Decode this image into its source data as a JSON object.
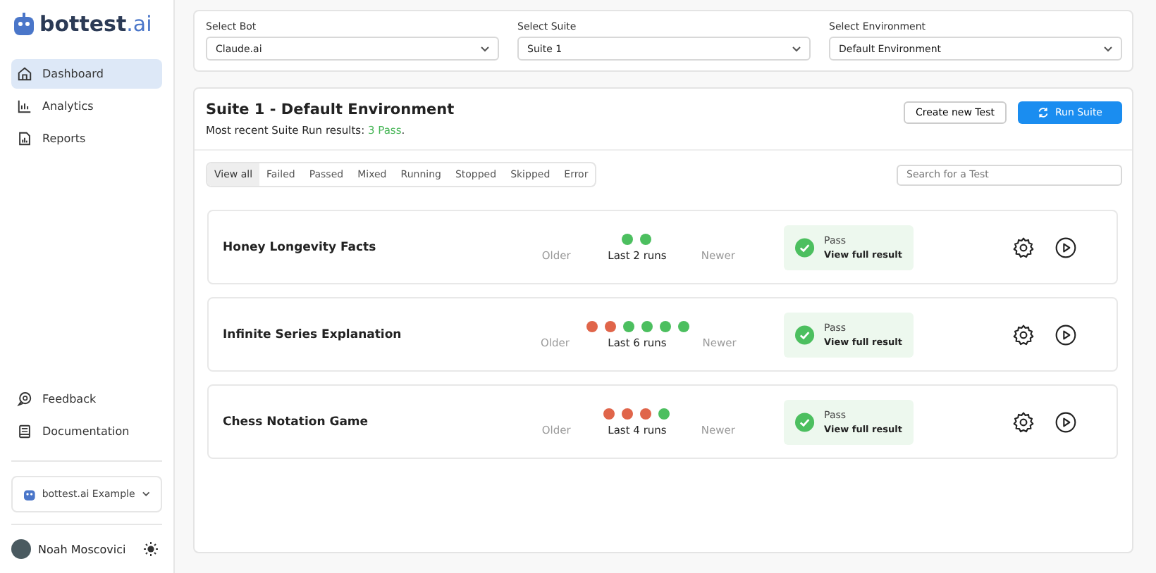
{
  "brand": {
    "name": "bottest",
    "suffix": ".ai"
  },
  "nav": [
    {
      "label": "Dashboard",
      "selected": true
    },
    {
      "label": "Analytics",
      "selected": false
    },
    {
      "label": "Reports",
      "selected": false
    }
  ],
  "bottom_nav": [
    {
      "label": "Feedback"
    },
    {
      "label": "Documentation"
    }
  ],
  "workspace": {
    "label": "bottest.ai Example"
  },
  "user": {
    "name": "Noah Moscovici"
  },
  "selects": [
    {
      "label": "Select Bot",
      "value": "Claude.ai"
    },
    {
      "label": "Select Suite",
      "value": "Suite 1"
    },
    {
      "label": "Select Environment",
      "value": "Default Environment"
    }
  ],
  "suite": {
    "title": "Suite 1 - Default Environment",
    "summary_prefix": "Most recent Suite Run results: ",
    "summary_result": "3 Pass",
    "summary_suffix": ".",
    "create_button": "Create new Test",
    "run_button": "Run Suite"
  },
  "filters": [
    {
      "label": "View all",
      "selected": true
    },
    {
      "label": "Failed",
      "selected": false
    },
    {
      "label": "Passed",
      "selected": false
    },
    {
      "label": "Mixed",
      "selected": false
    },
    {
      "label": "Running",
      "selected": false
    },
    {
      "label": "Stopped",
      "selected": false
    },
    {
      "label": "Skipped",
      "selected": false
    },
    {
      "label": "Error",
      "selected": false
    }
  ],
  "search": {
    "placeholder": "Search for a Test"
  },
  "tests": [
    {
      "name": "Honey Longevity Facts",
      "older": "Older",
      "runs_label": "Last 2 runs",
      "newer": "Newer",
      "runs": [
        {
          "color": "#4cbf5f"
        },
        {
          "color": "#4cbf5f"
        }
      ],
      "status": {
        "kind": "pass",
        "label": "Pass",
        "link": "View full result"
      }
    },
    {
      "name": "Infinite Series Explanation",
      "older": "Older",
      "runs_label": "Last 6 runs",
      "newer": "Newer",
      "runs": [
        {
          "color": "#e0654a"
        },
        {
          "color": "#e0654a"
        },
        {
          "color": "#4cbf5f"
        },
        {
          "color": "#4cbf5f"
        },
        {
          "color": "#4cbf5f"
        },
        {
          "color": "#4cbf5f"
        }
      ],
      "status": {
        "kind": "pass",
        "label": "Pass",
        "link": "View full result"
      }
    },
    {
      "name": "Chess Notation Game",
      "older": "Older",
      "runs_label": "Last 4 runs",
      "newer": "Newer",
      "runs": [
        {
          "color": "#e0654a"
        },
        {
          "color": "#e0654a"
        },
        {
          "color": "#e0654a"
        },
        {
          "color": "#4cbf5f"
        }
      ],
      "status": {
        "kind": "pass",
        "label": "Pass",
        "link": "View full result"
      }
    }
  ]
}
